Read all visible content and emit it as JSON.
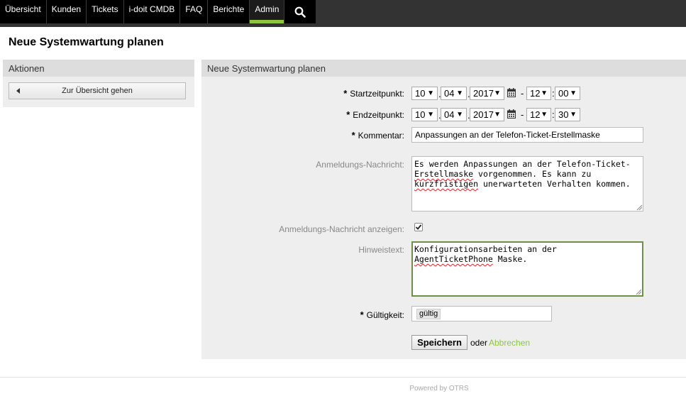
{
  "nav": {
    "items": [
      {
        "label": "Übersicht"
      },
      {
        "label": "Kunden"
      },
      {
        "label": "Tickets"
      },
      {
        "label": "i-doit CMDB"
      },
      {
        "label": "FAQ"
      },
      {
        "label": "Berichte"
      },
      {
        "label": "Admin",
        "active": true
      }
    ],
    "search_icon": "search-icon"
  },
  "page": {
    "title": "Neue Systemwartung planen"
  },
  "sidebar": {
    "header": "Aktionen",
    "back_button": "Zur Übersicht gehen"
  },
  "form": {
    "header": "Neue Systemwartung planen",
    "required_marker": "*",
    "start": {
      "label": "Startzeitpunkt:",
      "day": "10",
      "month": "04",
      "year": "2017",
      "hour": "12",
      "minute": "00"
    },
    "end": {
      "label": "Endzeitpunkt:",
      "day": "10",
      "month": "04",
      "year": "2017",
      "hour": "12",
      "minute": "30"
    },
    "separators": {
      "dot": ".",
      "dash": "-",
      "colon": ":"
    },
    "comment": {
      "label": "Kommentar:",
      "value": "Anpassungen an der Telefon-Ticket-Erstellmaske"
    },
    "login_message": {
      "label": "Anmeldungs-Nachricht:",
      "line1": "Es werden Anpassungen an der Telefon-Ticket-",
      "line2_spell": "Erstellmaske",
      "line2_rest": " vorgenommen. Es kann zu",
      "line3_spell": "kurzfristigen",
      "line3_rest": " unerwarteten Verhalten kommen."
    },
    "show_login_message": {
      "label": "Anmeldungs-Nachricht anzeigen:",
      "checked": true
    },
    "notify": {
      "label": "Hinweistext:",
      "line1": "Konfigurationsarbeiten an der",
      "line2_spell": "AgentTicketPhone",
      "line2_rest": " Maske."
    },
    "validity": {
      "label": "Gültigkeit:",
      "value": "gültig"
    },
    "save_button": "Speichern",
    "or_text": "oder",
    "cancel_link": "Abbrechen"
  },
  "footer": {
    "text": "Powered by OTRS"
  },
  "colors": {
    "accent": "#8cc63f",
    "nav_bg": "#000000",
    "panel_bg": "#eeeeee"
  }
}
